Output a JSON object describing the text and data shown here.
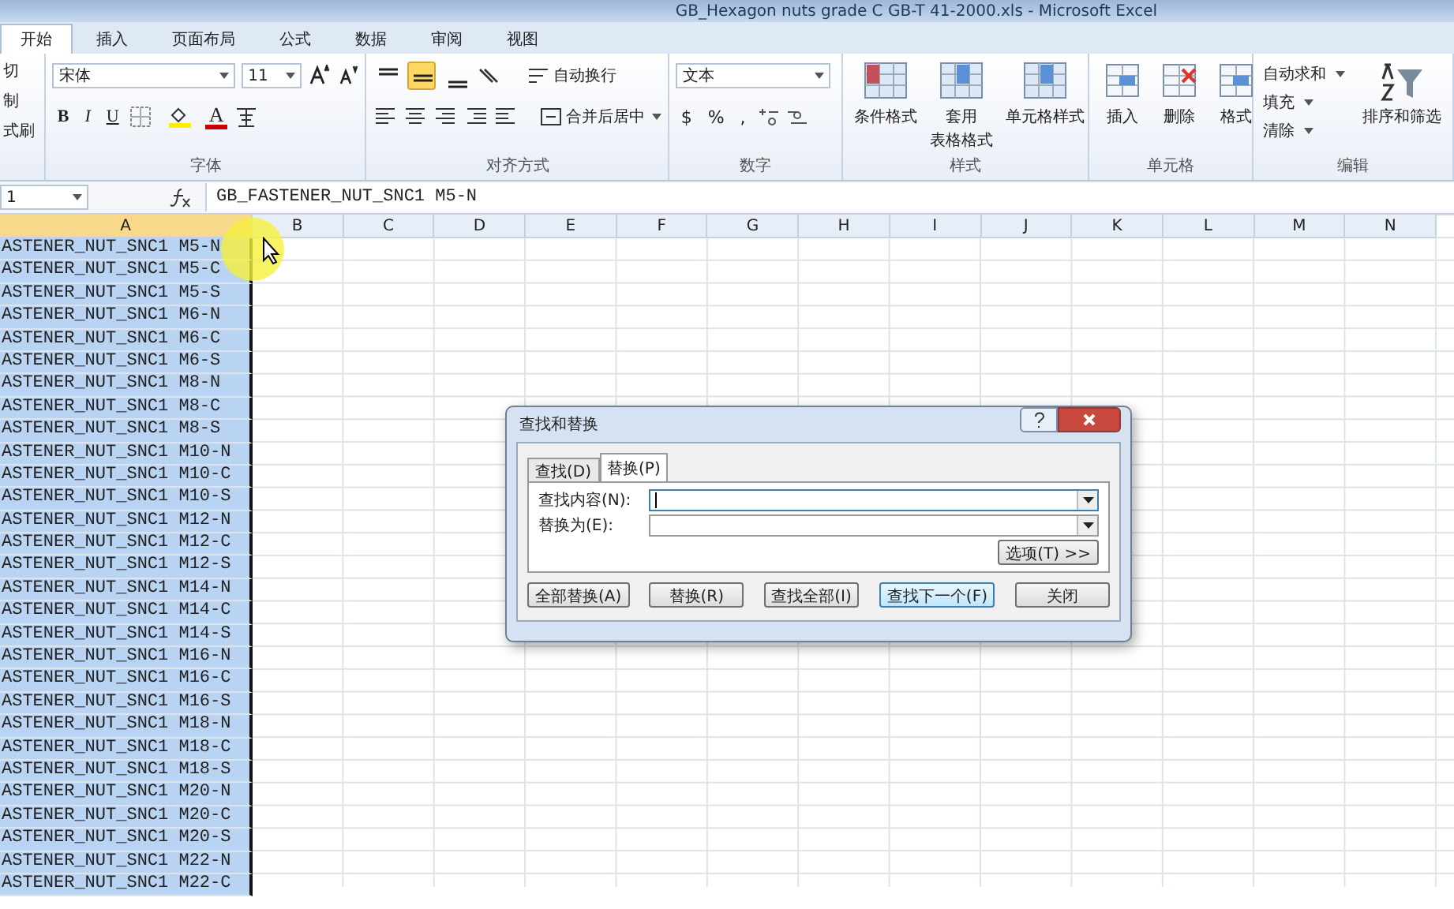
{
  "window": {
    "title": "GB_Hexagon nuts grade C GB-T 41-2000.xls - Microsoft Excel"
  },
  "tabs": [
    {
      "label": "开始",
      "selected": true
    },
    {
      "label": "插入",
      "selected": false
    },
    {
      "label": "页面布局",
      "selected": false
    },
    {
      "label": "公式",
      "selected": false
    },
    {
      "label": "数据",
      "selected": false
    },
    {
      "label": "审阅",
      "selected": false
    },
    {
      "label": "视图",
      "selected": false
    }
  ],
  "clipboard": {
    "items": [
      "切",
      "制",
      "式刷"
    ]
  },
  "font_group": {
    "label": "字体",
    "font": "宋体",
    "size": "11",
    "bold": "B",
    "italic": "I",
    "underline": "U",
    "font_color": "A"
  },
  "alignment_group": {
    "label": "对齐方式",
    "vertical_align": [
      {
        "selected": false
      },
      {
        "selected": true
      },
      {
        "selected": false
      }
    ],
    "wrap": "自动换行",
    "merge": "合并后居中"
  },
  "number_group": {
    "label": "数字",
    "format": "文本",
    "currency": "$",
    "percent": "%",
    "comma": ","
  },
  "styles_group": {
    "label": "样式",
    "buttons": [
      {
        "lines": [
          "条件格式"
        ]
      },
      {
        "lines": [
          "套用",
          "表格格式"
        ]
      },
      {
        "lines": [
          "单元格样式"
        ]
      }
    ]
  },
  "cells_group": {
    "label": "单元格",
    "buttons": [
      "插入",
      "删除",
      "格式"
    ]
  },
  "editing_group": {
    "label": "编辑",
    "items": [
      "自动求和",
      "填充",
      "清除"
    ],
    "sort": "排序和筛选"
  },
  "formula_bar": {
    "name_box": "1",
    "formula": "GB_FASTENER_NUT_SNC1 M5-N"
  },
  "sheet": {
    "columns": [
      {
        "label": "A",
        "selected": true
      },
      {
        "label": "B",
        "selected": false
      },
      {
        "label": "C",
        "selected": false
      },
      {
        "label": "D",
        "selected": false
      },
      {
        "label": "E",
        "selected": false
      },
      {
        "label": "F",
        "selected": false
      },
      {
        "label": "G",
        "selected": false
      },
      {
        "label": "H",
        "selected": false
      },
      {
        "label": "I",
        "selected": false
      },
      {
        "label": "J",
        "selected": false
      },
      {
        "label": "K",
        "selected": false
      },
      {
        "label": "L",
        "selected": false
      },
      {
        "label": "M",
        "selected": false
      },
      {
        "label": "N",
        "selected": false
      }
    ],
    "rows": [
      "ASTENER_NUT_SNC1 M5-N",
      "ASTENER_NUT_SNC1 M5-C",
      "ASTENER_NUT_SNC1 M5-S",
      "ASTENER_NUT_SNC1 M6-N",
      "ASTENER_NUT_SNC1 M6-C",
      "ASTENER_NUT_SNC1 M6-S",
      "ASTENER_NUT_SNC1 M8-N",
      "ASTENER_NUT_SNC1 M8-C",
      "ASTENER_NUT_SNC1 M8-S",
      "ASTENER_NUT_SNC1 M10-N",
      "ASTENER_NUT_SNC1 M10-C",
      "ASTENER_NUT_SNC1 M10-S",
      "ASTENER_NUT_SNC1 M12-N",
      "ASTENER_NUT_SNC1 M12-C",
      "ASTENER_NUT_SNC1 M12-S",
      "ASTENER_NUT_SNC1 M14-N",
      "ASTENER_NUT_SNC1 M14-C",
      "ASTENER_NUT_SNC1 M14-S",
      "ASTENER_NUT_SNC1 M16-N",
      "ASTENER_NUT_SNC1 M16-C",
      "ASTENER_NUT_SNC1 M16-S",
      "ASTENER_NUT_SNC1 M18-N",
      "ASTENER_NUT_SNC1 M18-C",
      "ASTENER_NUT_SNC1 M18-S",
      "ASTENER_NUT_SNC1 M20-N",
      "ASTENER_NUT_SNC1 M20-C",
      "ASTENER_NUT_SNC1 M20-S",
      "ASTENER_NUT_SNC1 M22-N",
      "ASTENER_NUT_SNC1 M22-C"
    ]
  },
  "dialog": {
    "title": "查找和替换",
    "tabs": [
      {
        "label": "查找(D)",
        "selected": false
      },
      {
        "label": "替换(P)",
        "selected": true
      }
    ],
    "fields": [
      {
        "label": "查找内容(N):",
        "focused": true
      },
      {
        "label": "替换为(E):",
        "focused": false
      }
    ],
    "options_button": "选项(T) >>",
    "buttons": [
      {
        "label": "全部替换(A)",
        "default": false
      },
      {
        "label": "替换(R)",
        "default": false
      },
      {
        "label": "查找全部(I)",
        "default": false
      },
      {
        "label": "查找下一个(F)",
        "default": true
      },
      {
        "label": "关闭",
        "default": false
      }
    ]
  }
}
